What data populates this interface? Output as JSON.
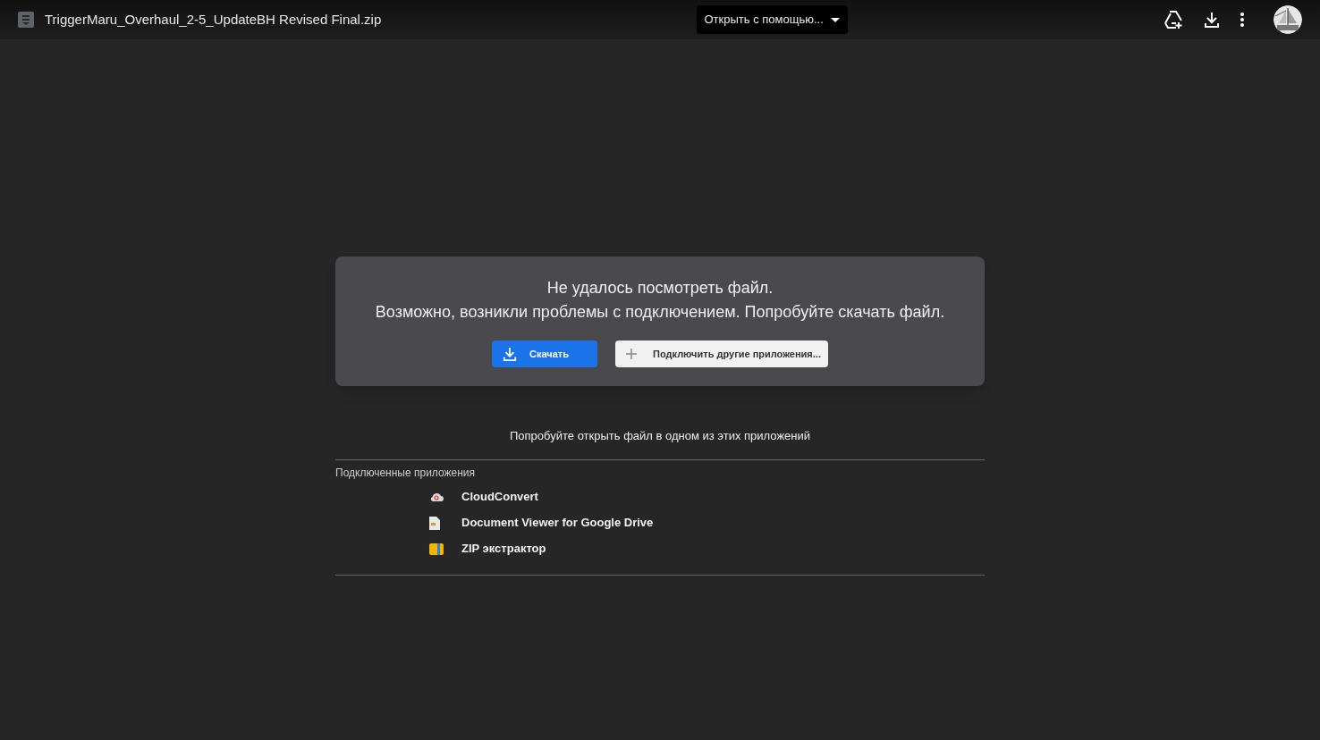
{
  "top_bar": {
    "file_name": "TriggerMaru_Overhaul_2-5_UpdateBH Revised Final.zip",
    "open_with": "Открыть с помощью..."
  },
  "error_card": {
    "title": "Не удалось посмотреть файл.",
    "message": "Возможно, возникли проблемы с подключением. Попробуйте скачать файл.",
    "download_button": "Скачать",
    "connect_button": "Подключить другие приложения..."
  },
  "suggestion": "Попробуйте открыть файл в одном из этих приложений",
  "connected_apps": {
    "heading": "Подключенные приложения",
    "items": [
      {
        "kind": "cloud",
        "name": "CloudConvert"
      },
      {
        "kind": "document",
        "name": "Document Viewer for Google Drive"
      },
      {
        "kind": "archive",
        "name": "ZIP экстрактор"
      }
    ]
  }
}
